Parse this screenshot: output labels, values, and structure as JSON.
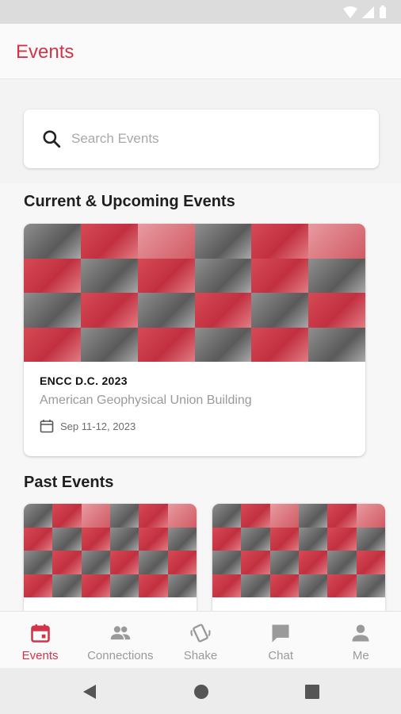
{
  "app": {
    "title": "Events"
  },
  "search": {
    "placeholder": "Search Events"
  },
  "sections": {
    "current_title": "Current & Upcoming Events",
    "past_title": "Past Events"
  },
  "current_event": {
    "name": "ENCC D.C. 2023",
    "venue": "American Geophysical Union Building",
    "date": "Sep 11-12, 2023"
  },
  "bottom_nav": {
    "items": [
      {
        "label": "Events",
        "icon": "calendar-icon",
        "active": true
      },
      {
        "label": "Connections",
        "icon": "people-icon",
        "active": false
      },
      {
        "label": "Shake",
        "icon": "shake-phone-icon",
        "active": false
      },
      {
        "label": "Chat",
        "icon": "chat-icon",
        "active": false
      },
      {
        "label": "Me",
        "icon": "person-icon",
        "active": false
      }
    ]
  },
  "colors": {
    "accent": "#d2354a",
    "inactive": "#9a9a9a"
  }
}
